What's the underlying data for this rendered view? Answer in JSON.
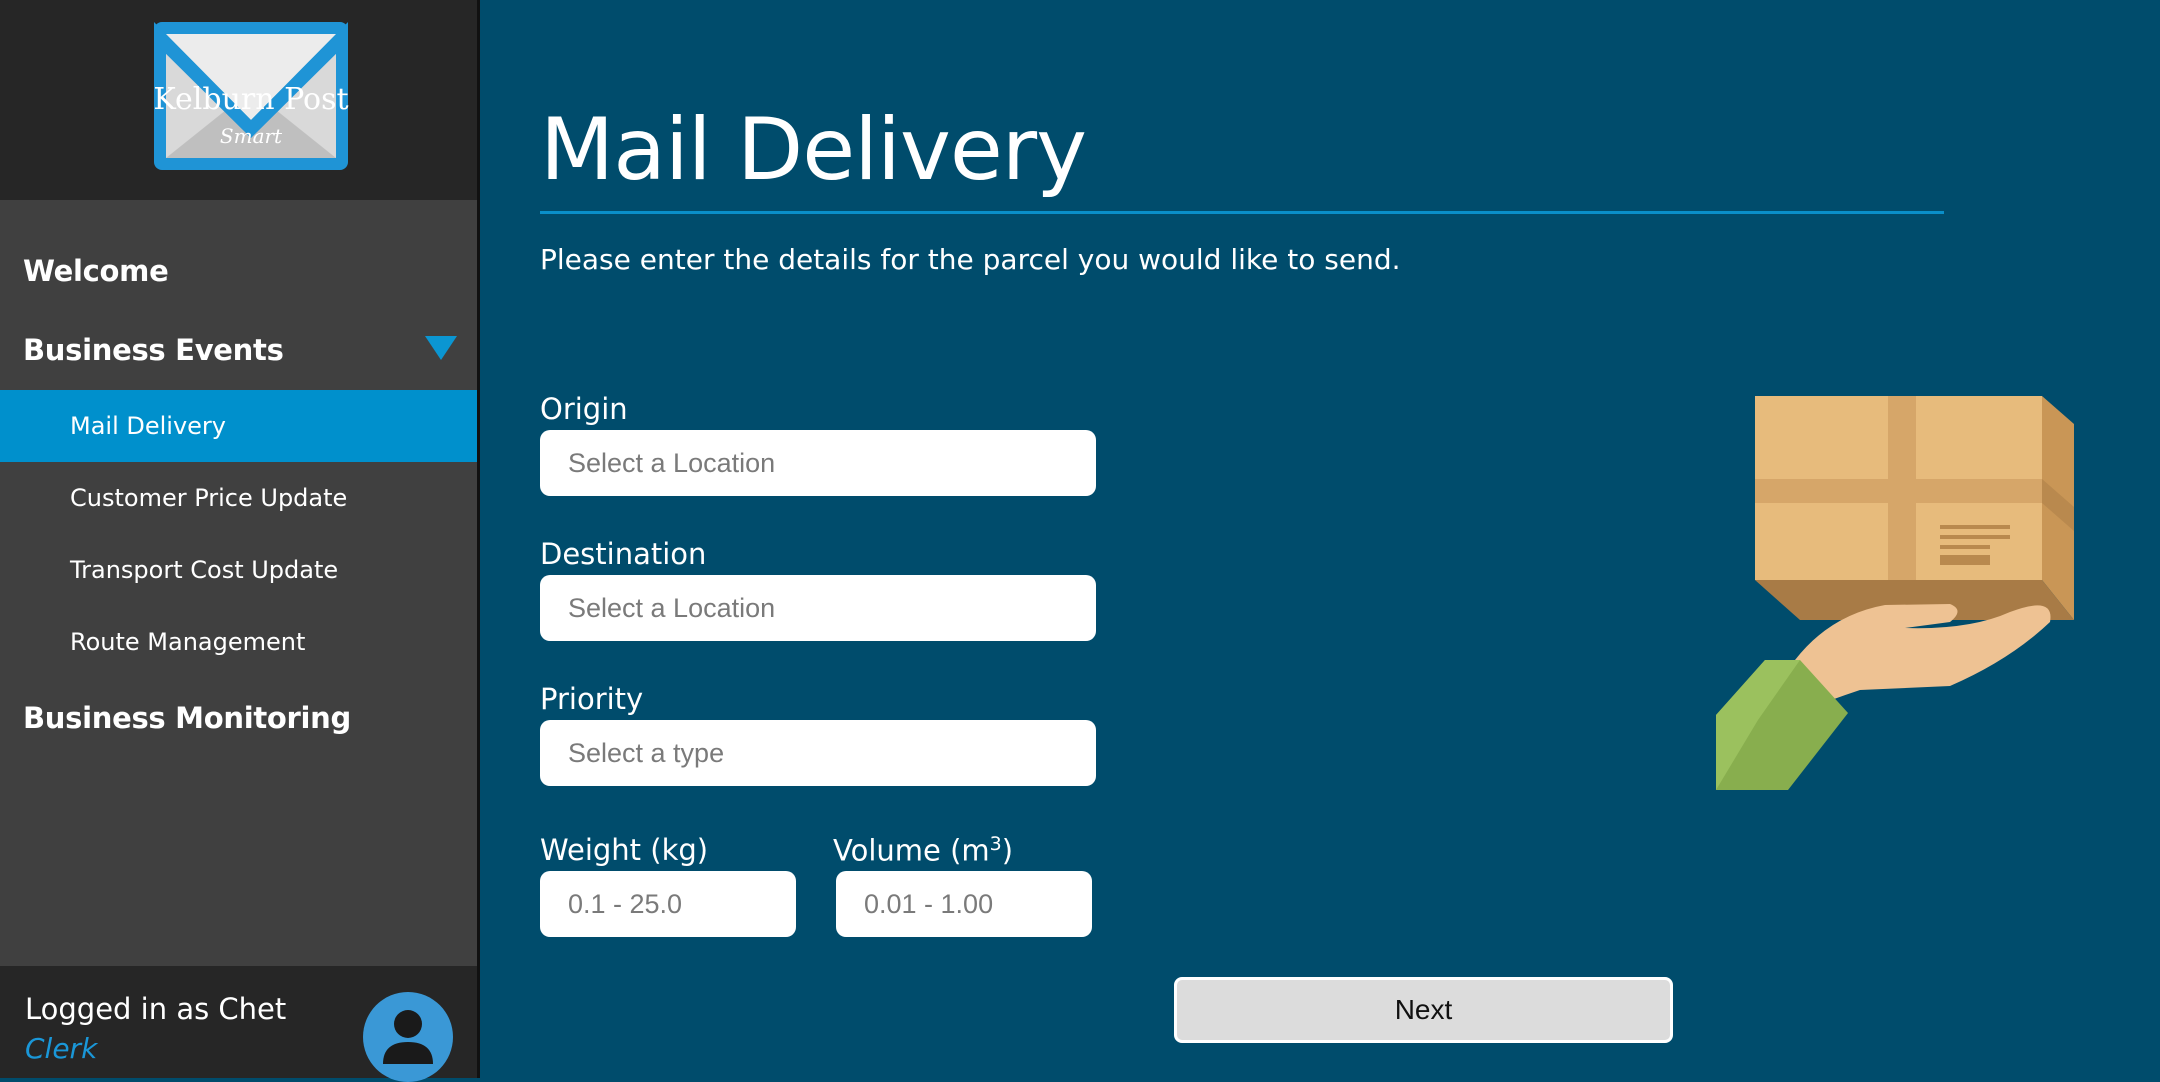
{
  "logo": {
    "title": "Kelburn Post",
    "subtitle": "Smart"
  },
  "sidebar": {
    "welcome": "Welcome",
    "business_events": "Business Events",
    "sub_items": [
      {
        "label": "Mail Delivery",
        "active": true
      },
      {
        "label": "Customer Price Update",
        "active": false
      },
      {
        "label": "Transport Cost Update",
        "active": false
      },
      {
        "label": "Route Management",
        "active": false
      }
    ],
    "business_monitoring": "Business Monitoring",
    "caret_icon": "caret-down-icon"
  },
  "user": {
    "logged_in_text": "Logged in as Chet",
    "role": "Clerk",
    "avatar_icon": "user-icon"
  },
  "main": {
    "title": "Mail Delivery",
    "subtitle": "Please enter the details for the parcel you would like to send.",
    "origin": {
      "label": "Origin",
      "placeholder": "Select a Location"
    },
    "destination": {
      "label": "Destination",
      "placeholder": "Select a Location"
    },
    "priority": {
      "label": "Priority",
      "placeholder": "Select a type"
    },
    "weight": {
      "label": "Weight (kg)",
      "placeholder": "0.1 - 25.0"
    },
    "volume": {
      "label_prefix": "Volume (m",
      "label_sup": "3",
      "label_suffix": ")",
      "placeholder": "0.01 - 1.00"
    },
    "next_label": "Next",
    "illustration_icon": "hand-holding-parcel-illustration"
  },
  "colors": {
    "background": "#004c6c",
    "sidebar": "#404040",
    "sidebar_dark": "#262626",
    "accent": "#0090cc",
    "role_text": "#1a97d8"
  }
}
